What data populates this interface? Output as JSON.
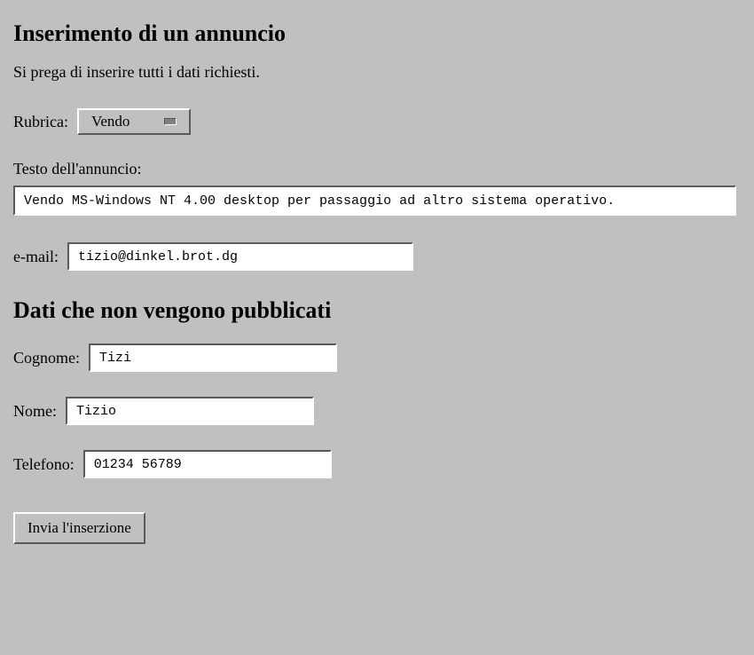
{
  "heading1": "Inserimento di un annuncio",
  "intro": "Si prega di inserire tutti i dati richiesti.",
  "labels": {
    "rubrica": "Rubrica:",
    "testo": "Testo dell'annuncio:",
    "email": "e-mail:",
    "cognome": "Cognome:",
    "nome": "Nome:",
    "telefono": "Telefono:"
  },
  "values": {
    "rubrica_selected": "Vendo",
    "testo": "Vendo MS-Windows NT 4.00 desktop per passaggio ad altro sistema operativo.",
    "email": "tizio@dinkel.brot.dg",
    "cognome": "Tizi",
    "nome": "Tizio",
    "telefono": "01234 56789"
  },
  "heading2": "Dati che non vengono pubblicati",
  "submit_label": "Invia l'inserzione"
}
